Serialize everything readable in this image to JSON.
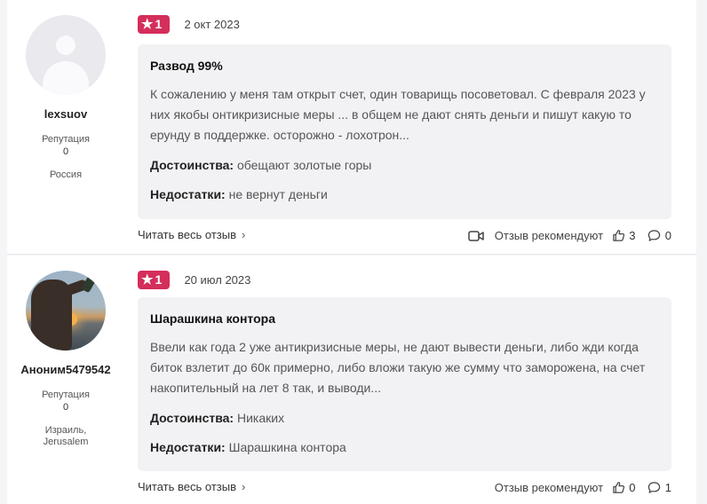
{
  "reviews": [
    {
      "user": {
        "name": "lexsuov",
        "rep_label": "Репутация",
        "rep_value": "0",
        "country": "Россия",
        "avatar": "default-avatar"
      },
      "rating": "1",
      "date": "2 окт 2023",
      "title": "Развод 99%",
      "text": "К сожалению у меня там открыт счет, один товарищь посоветовал. С февраля 2023 у них якобы онтикризисные меры ... в общем не дают снять деньги и пишут какую то ерунду в поддержке. осторожно - лохотрон...",
      "pros_label": "Достоинства:",
      "pros": "обещают золотые горы",
      "cons_label": "Недостатки:",
      "cons": "не вернут деньги",
      "read_more": "Читать весь отзыв",
      "recommend": "Отзыв рекомендуют",
      "likes": "3",
      "comments": "0",
      "has_video": true
    },
    {
      "user": {
        "name": "Аноним5479542",
        "rep_label": "Репутация",
        "rep_value": "0",
        "country": "Израиль, Jerusalem",
        "avatar": "photo-avatar"
      },
      "rating": "1",
      "date": "20 июл 2023",
      "title": "Шарашкина контора",
      "text": "Ввели как года 2 уже антикризисные меры, не дают вывести деньги, либо жди когда биток взлетит до 60к примерно, либо вложи такую же сумму что заморожена, на счет накопительный на лет 8 так, и выводи...",
      "pros_label": "Достоинства:",
      "pros": "Никаких",
      "cons_label": "Недостатки:",
      "cons": "Шарашкина контора",
      "read_more": "Читать весь отзыв",
      "recommend": "Отзыв рекомендуют",
      "likes": "0",
      "comments": "1",
      "has_video": false
    }
  ],
  "colors": {
    "badge": "#d42e5b",
    "review_bg": "#f2f2f5",
    "page_bg": "#f4f5f7"
  },
  "icons": [
    "star-icon",
    "chevron-right-icon",
    "video-icon",
    "thumbs-up-icon",
    "comment-icon"
  ]
}
